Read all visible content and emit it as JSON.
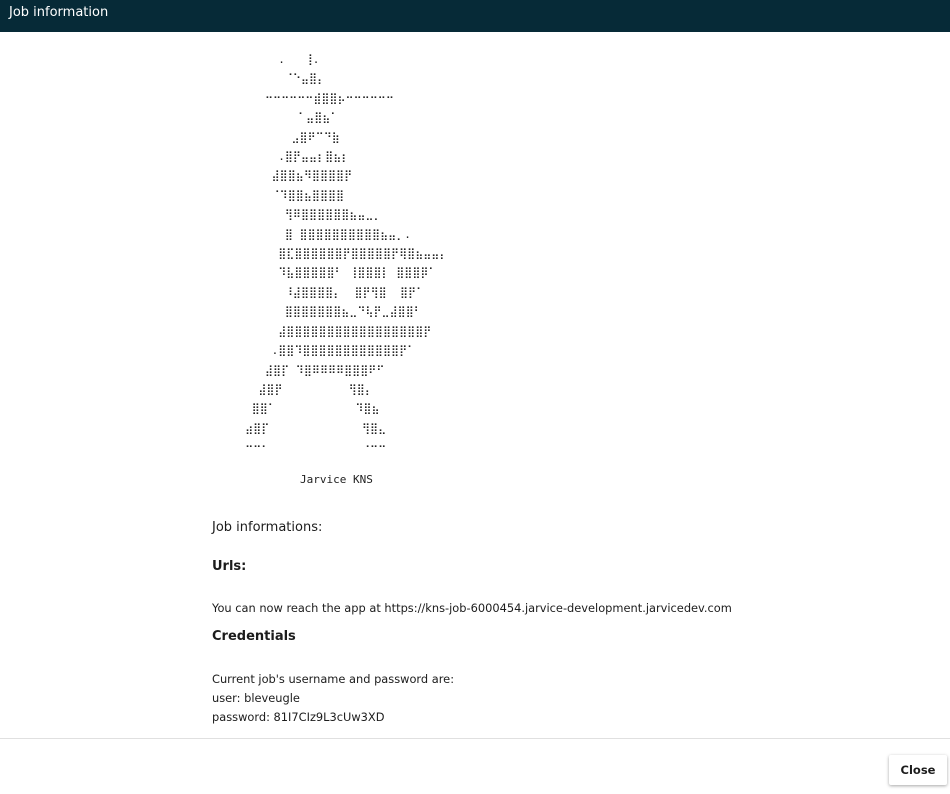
{
  "dialog": {
    "title": "Job information"
  },
  "content": {
    "ascii_art": "          .   ⢸.\n           ⠈⠑⣤⣿⡄\n        ⠒⠒⠒⠒⠒⠒⣾⣿⣿⡦⠒⠒⠒⠒⠒⠒\n             ⠁⣤⣿⣦⠁\n            ⣠⣿⠟⠉⠙⣷\n          .⣿⡟⣤⣤⡆⣿⣦⡆\n         ⣼⣿⣿⣦⠻⣿⣿⣿⣿⡟\n         ⠈⠹⣿⣿⣦⣿⣿⣿⣿\n           ⢻⠿⣿⣿⣿⣿⣿⣿⣦⣤⣀⡀\n           ⣿ ⣿⣿⣿⣿⣿⣿⣿⣿⣿⣿⣦⣤⡀.\n          ⣿⣏⣿⣿⣿⣿⣿⣿⡟⣿⣿⣿⣿⣿⡟⢿⣿⣦⣤⣤⡄\n          ⠹⣧⣿⣿⣿⣿⣿⠃ ⢸⣿⣿⣿⡇ ⣿⣿⣿⡿⠁\n           ⠸⣼⣿⣿⣿⣿⡄  ⣿⡟⢻⣿  ⣿⡟⠁\n           ⣿⣿⣿⣿⣿⣿⣿⣦⣀⠙⢧⡟⣀⣼⣿⣿⠃\n          ⣼⣿⣿⣿⣿⣿⣿⣿⣿⣿⣿⣿⣿⣿⣿⣿⣿⣿⡟\n         .⣿⣿⠹⣿⣿⣿⣿⣿⣿⣿⣿⣿⣿⣿⣿⡟⠁\n        ⣼⣿⡏ ⠹⣿⠿⠿⠿⠿⣿⣿⣿⠟⠋\n       ⣼⣿⡟          ⢻⣿⡄\n      ⣿⣿⠁            ⠹⣿⣦\n     ⣴⣿⡏              ⢻⣿⣄\n     ⠒⠒⠂              ⠐⠒⠒",
    "caption": "Jarvice KNS",
    "job_informations_label": "Job informations:",
    "urls_heading": "Urls:",
    "url_text": "You can now reach the app at https://kns-job-6000454.jarvice-development.jarvicedev.com",
    "credentials_heading": "Credentials",
    "credentials_intro": "Current job's username and password are:",
    "user_line": "user: bleveugle",
    "password_line": "password: 81I7CIz9L3cUw3XD"
  },
  "footer": {
    "close_label": "Close"
  }
}
